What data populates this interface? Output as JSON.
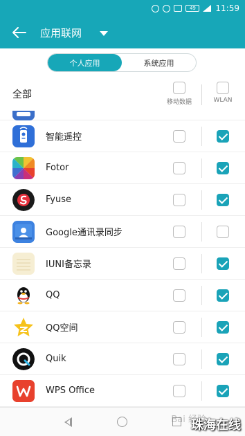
{
  "status_bar": {
    "battery": "49",
    "time": "11:59"
  },
  "app_bar": {
    "title": "应用联网"
  },
  "tabs": [
    {
      "label": "个人应用",
      "active": true
    },
    {
      "label": "系统应用",
      "active": false
    }
  ],
  "header": {
    "all_label": "全部",
    "mobile_data_label": "移动数据",
    "wlan_label": "WLAN",
    "all_mobile_checked": false,
    "all_wlan_checked": false
  },
  "apps": [
    {
      "name": "",
      "icon": "partial-app-icon",
      "mobile": false,
      "wlan": false,
      "partial": true
    },
    {
      "name": "智能遥控",
      "icon": "remote-control-icon",
      "mobile": false,
      "wlan": true
    },
    {
      "name": "Fotor",
      "icon": "fotor-icon",
      "mobile": false,
      "wlan": true
    },
    {
      "name": "Fyuse",
      "icon": "fyuse-icon",
      "mobile": false,
      "wlan": true
    },
    {
      "name": "Google通讯录同步",
      "icon": "google-contacts-icon",
      "mobile": false,
      "wlan": false
    },
    {
      "name": "IUNI备忘录",
      "icon": "notepad-icon",
      "mobile": false,
      "wlan": true
    },
    {
      "name": "QQ",
      "icon": "qq-penguin-icon",
      "mobile": false,
      "wlan": true
    },
    {
      "name": "QQ空间",
      "icon": "qzone-star-icon",
      "mobile": false,
      "wlan": true
    },
    {
      "name": "Quik",
      "icon": "quik-icon",
      "mobile": false,
      "wlan": true
    },
    {
      "name": "WPS Office",
      "icon": "wps-office-icon",
      "mobile": false,
      "wlan": true
    }
  ],
  "watermark": {
    "text": "珠海在线",
    "baidu": "Bai 经验"
  },
  "colors": {
    "accent": "#17a7b8",
    "checkbox": "#1aa3b8"
  }
}
